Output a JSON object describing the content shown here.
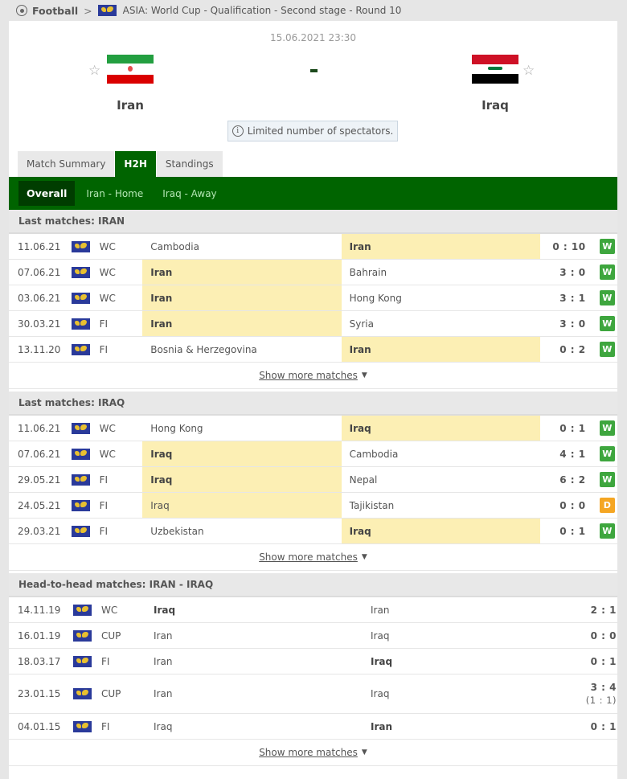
{
  "breadcrumb": {
    "sport": "Football",
    "league": "ASIA: World Cup - Qualification - Second stage - Round 10"
  },
  "match": {
    "datetime": "15.06.2021 23:30",
    "home": {
      "name": "Iran",
      "flag": "iran-flag"
    },
    "away": {
      "name": "Iraq",
      "flag": "iraq-flag"
    },
    "score": "-",
    "info": "Limited number of spectators."
  },
  "tabs": [
    {
      "label": "Match Summary",
      "active": false
    },
    {
      "label": "H2H",
      "active": true
    },
    {
      "label": "Standings",
      "active": false
    }
  ],
  "subtabs": [
    {
      "label": "Overall",
      "active": true
    },
    {
      "label": "Iran - Home",
      "active": false
    },
    {
      "label": "Iraq - Away",
      "active": false
    }
  ],
  "colors": {
    "primary_green": "#006400",
    "win": "#3ea63e",
    "draw": "#f5a623",
    "highlight": "#fcefb4"
  },
  "sections": [
    {
      "title": "Last matches: IRAN",
      "show_more": "Show more matches",
      "rows": [
        {
          "date": "11.06.21",
          "comp": "WC",
          "home": "Cambodia",
          "away": "Iran",
          "score": "0 : 10",
          "result": "W",
          "hl": "away",
          "bold": "away"
        },
        {
          "date": "07.06.21",
          "comp": "WC",
          "home": "Iran",
          "away": "Bahrain",
          "score": "3 : 0",
          "result": "W",
          "hl": "home",
          "bold": "home"
        },
        {
          "date": "03.06.21",
          "comp": "WC",
          "home": "Iran",
          "away": "Hong Kong",
          "score": "3 : 1",
          "result": "W",
          "hl": "home",
          "bold": "home"
        },
        {
          "date": "30.03.21",
          "comp": "FI",
          "home": "Iran",
          "away": "Syria",
          "score": "3 : 0",
          "result": "W",
          "hl": "home",
          "bold": "home"
        },
        {
          "date": "13.11.20",
          "comp": "FI",
          "home": "Bosnia & Herzegovina",
          "away": "Iran",
          "score": "0 : 2",
          "result": "W",
          "hl": "away",
          "bold": "away"
        }
      ]
    },
    {
      "title": "Last matches: IRAQ",
      "show_more": "Show more matches",
      "rows": [
        {
          "date": "11.06.21",
          "comp": "WC",
          "home": "Hong Kong",
          "away": "Iraq",
          "score": "0 : 1",
          "result": "W",
          "hl": "away",
          "bold": "away"
        },
        {
          "date": "07.06.21",
          "comp": "WC",
          "home": "Iraq",
          "away": "Cambodia",
          "score": "4 : 1",
          "result": "W",
          "hl": "home",
          "bold": "home"
        },
        {
          "date": "29.05.21",
          "comp": "FI",
          "home": "Iraq",
          "away": "Nepal",
          "score": "6 : 2",
          "result": "W",
          "hl": "home",
          "bold": "home"
        },
        {
          "date": "24.05.21",
          "comp": "FI",
          "home": "Iraq",
          "away": "Tajikistan",
          "score": "0 : 0",
          "result": "D",
          "hl": "home",
          "bold": ""
        },
        {
          "date": "29.03.21",
          "comp": "FI",
          "home": "Uzbekistan",
          "away": "Iraq",
          "score": "0 : 1",
          "result": "W",
          "hl": "away",
          "bold": "away"
        }
      ]
    },
    {
      "title": "Head-to-head matches: IRAN - IRAQ",
      "show_more": "Show more matches",
      "rows": [
        {
          "date": "14.11.19",
          "comp": "WC",
          "home": "Iraq",
          "away": "Iran",
          "score": "2 : 1",
          "bold": "home"
        },
        {
          "date": "16.01.19",
          "comp": "CUP",
          "home": "Iran",
          "away": "Iraq",
          "score": "0 : 0",
          "bold": ""
        },
        {
          "date": "18.03.17",
          "comp": "FI",
          "home": "Iran",
          "away": "Iraq",
          "score": "0 : 1",
          "bold": "away"
        },
        {
          "date": "23.01.15",
          "comp": "CUP",
          "home": "Iran",
          "away": "Iraq",
          "score": "3 : 4",
          "sub_score": "(1 : 1)",
          "bold": ""
        },
        {
          "date": "04.01.15",
          "comp": "FI",
          "home": "Iraq",
          "away": "Iran",
          "score": "0 : 1",
          "bold": "away"
        }
      ]
    }
  ]
}
